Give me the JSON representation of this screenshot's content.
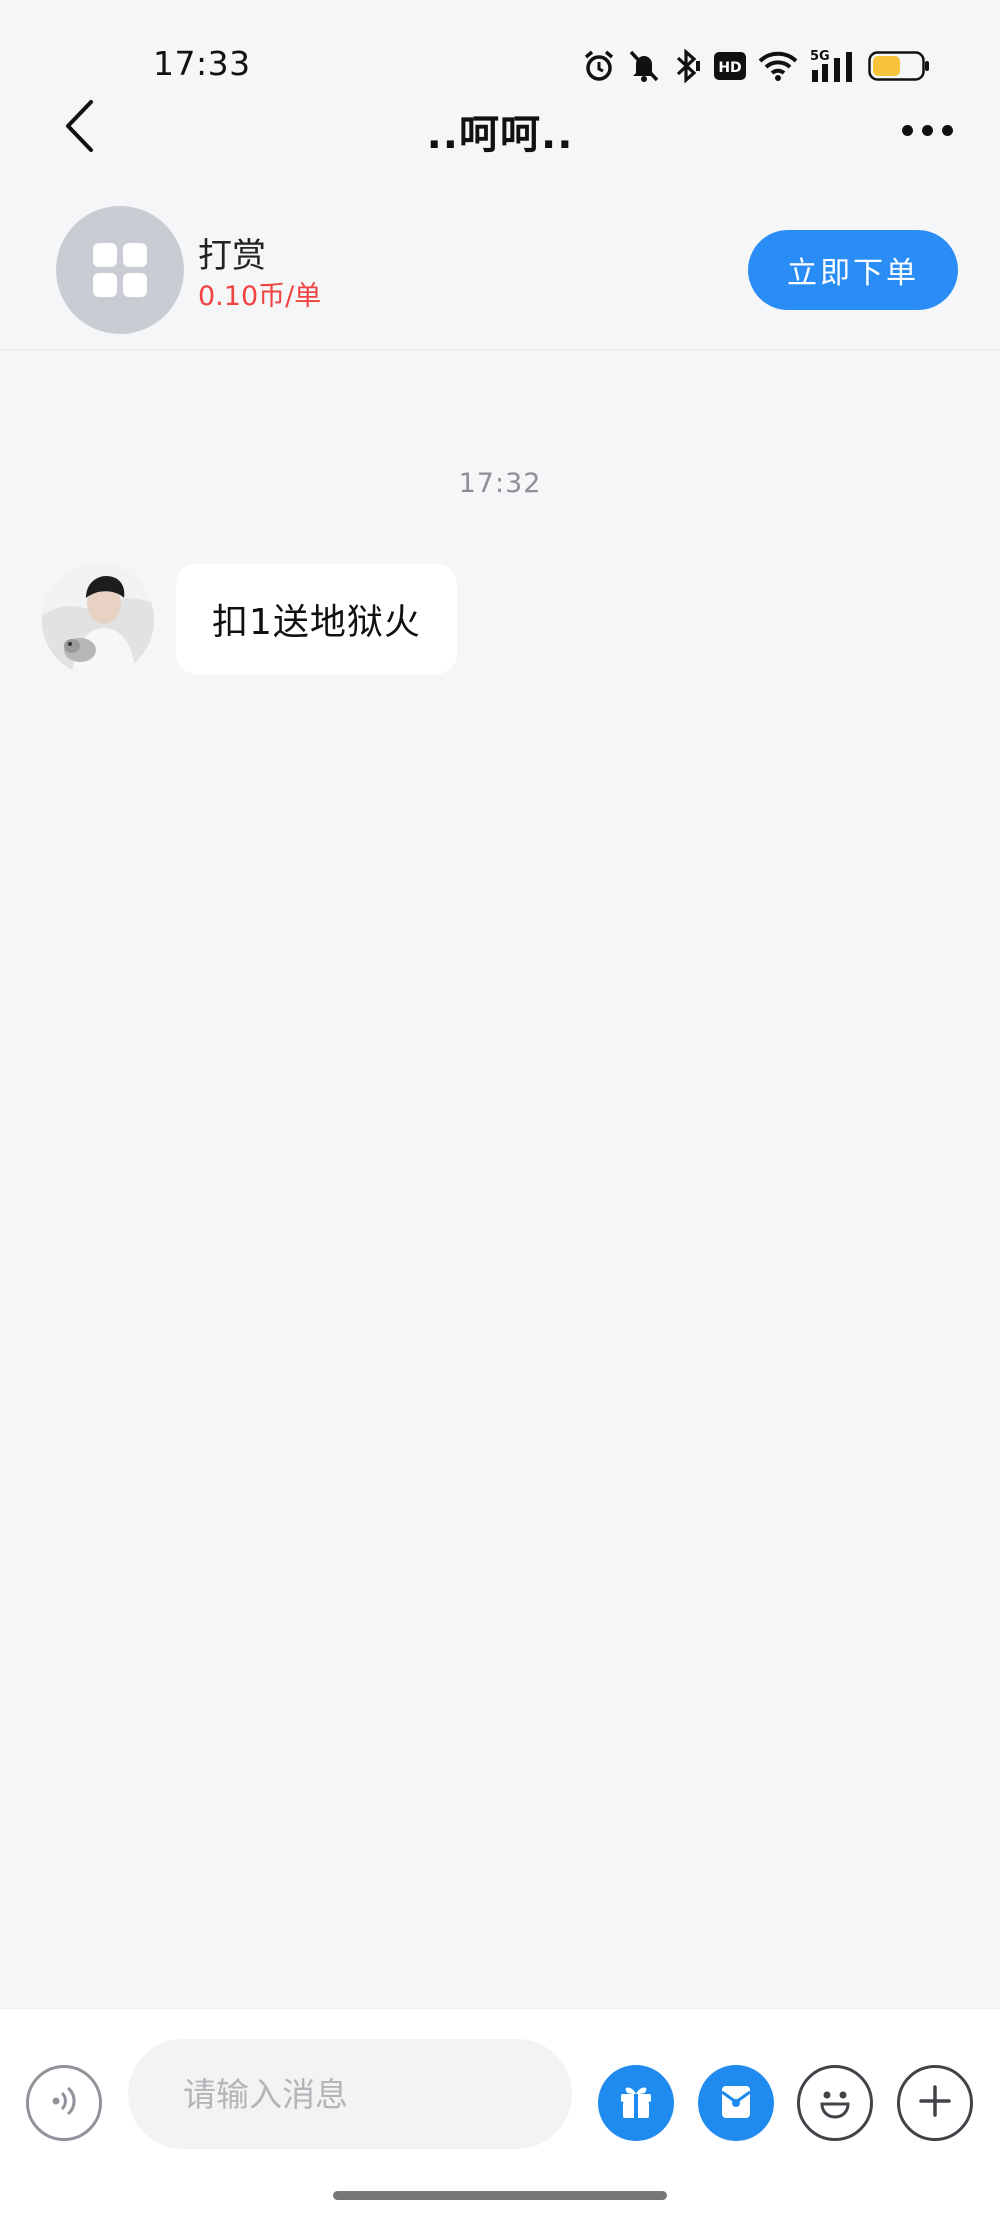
{
  "status_bar": {
    "time": "17:33",
    "icons": [
      "alarm-icon",
      "mute-bell-icon",
      "bluetooth-icon",
      "hd-icon",
      "wifi-icon",
      "5g-signal-icon",
      "battery-icon"
    ],
    "hd_text": "HD",
    "network_text": "5G",
    "battery_color": "#f6c33a"
  },
  "header": {
    "title": "..呵呵..",
    "back_icon": "chevron-left-icon",
    "more_icon": "more-dots-icon"
  },
  "service_card": {
    "name": "打赏",
    "price": "0.10币/单",
    "price_color": "#f0433f",
    "order_button_label": "立即下单",
    "accent_color": "#2a8df5"
  },
  "chat": {
    "timestamp": "17:32",
    "messages": [
      {
        "from": "other",
        "text": "扣1送地狱火"
      }
    ]
  },
  "composer": {
    "placeholder": "请输入消息",
    "buttons": [
      "voice-icon",
      "gift-icon",
      "red-packet-icon",
      "emoji-icon",
      "plus-icon"
    ]
  }
}
